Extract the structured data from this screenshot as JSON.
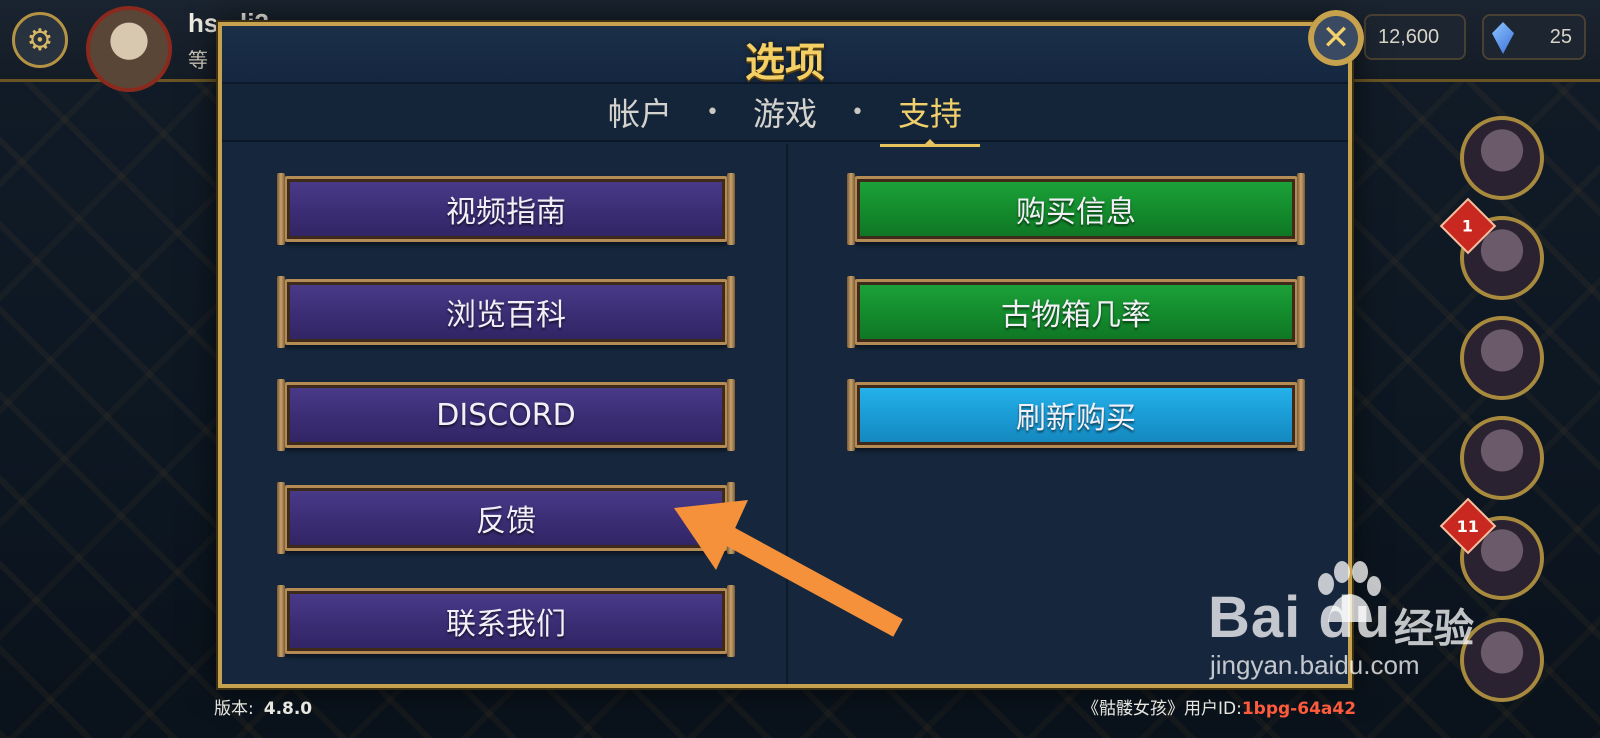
{
  "topbar": {
    "player_name": "hs...li3",
    "player_level": "等",
    "coins": "12,600",
    "gems": "25"
  },
  "side_badges": [
    "1",
    "11"
  ],
  "modal": {
    "title": "选项",
    "tabs": [
      {
        "label": "帐户",
        "active": false
      },
      {
        "label": "游戏",
        "active": false
      },
      {
        "label": "支持",
        "active": true
      }
    ],
    "tab_separator": "•",
    "left_buttons": [
      "视频指南",
      "浏览百科",
      "DISCORD",
      "反馈",
      "联系我们"
    ],
    "right_buttons": [
      "购买信息",
      "古物箱几率",
      "刷新购买"
    ],
    "close_icon": "close-icon"
  },
  "footer": {
    "version_label": "版本:",
    "version_number": "4.8.0",
    "game_name": "《骷髅女孩》用户ID:",
    "user_id": "1bpg-64a42"
  },
  "watermark": {
    "brand": "Bai du",
    "suffix": "经验",
    "url": "jingyan.baidu.com"
  },
  "colors": {
    "gold": "#c6a24e",
    "purple_button": "#3b2d74",
    "green_button": "#138a2c",
    "blue_button": "#1a9ad3",
    "arrow": "#f5913a"
  }
}
